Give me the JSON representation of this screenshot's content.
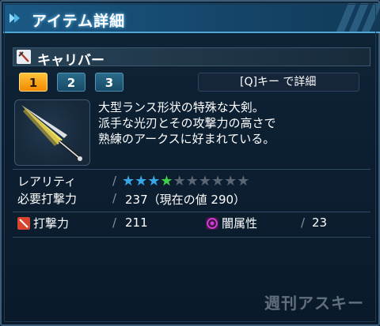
{
  "window": {
    "title": "アイテム詳細"
  },
  "item": {
    "name": "キャリバー",
    "icon": "sword-icon"
  },
  "tabs": [
    {
      "label": "1",
      "active": true
    },
    {
      "label": "2",
      "active": false
    },
    {
      "label": "3",
      "active": false
    }
  ],
  "detail_hint": "[Q]キー で詳細",
  "description": [
    "大型ランス形状の特殊な大剣。",
    "派手な光刃とその攻撃力の高さで",
    "熟練のアークスに好まれている。"
  ],
  "stats": {
    "rarity": {
      "label": "レアリティ",
      "value": 4,
      "max": 10
    },
    "required": {
      "label": "必要打撃力",
      "value": "237（現在の値 290）"
    },
    "attack": {
      "label": "打撃力",
      "value": "211",
      "icon": "melee-attack-icon"
    },
    "element": {
      "label": "闇属性",
      "value": "23",
      "icon": "dark-element-icon"
    }
  },
  "watermark": "週刊アスキー",
  "colors": {
    "accent": "#4fa7d8",
    "tab_active": "#f08a00",
    "star_blue": "#36a8e8",
    "star_green": "#3fd14a",
    "star_empty": "#5a6672",
    "element_magenta": "#d23ad6",
    "attack_red": "#d8452e"
  }
}
